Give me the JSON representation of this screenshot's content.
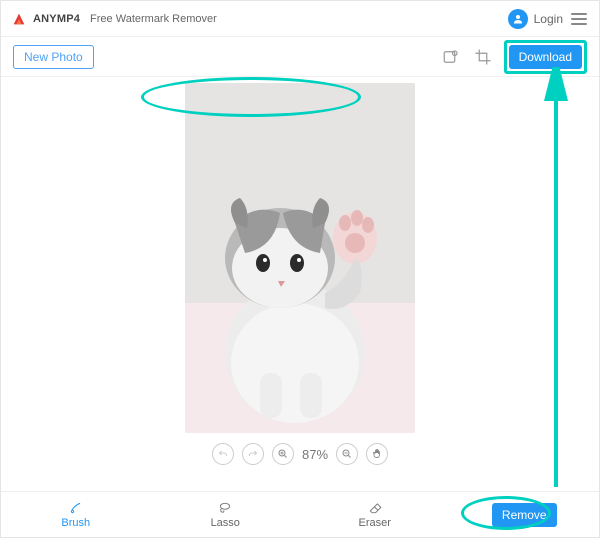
{
  "header": {
    "brand": "ANYMP4",
    "app_title": "Free Watermark Remover",
    "login_label": "Login"
  },
  "toolbar": {
    "new_photo_label": "New Photo",
    "download_label": "Download"
  },
  "zoom": {
    "value": "87%"
  },
  "tools": {
    "brush": "Brush",
    "lasso": "Lasso",
    "eraser": "Eraser",
    "remove_label": "Remove"
  }
}
